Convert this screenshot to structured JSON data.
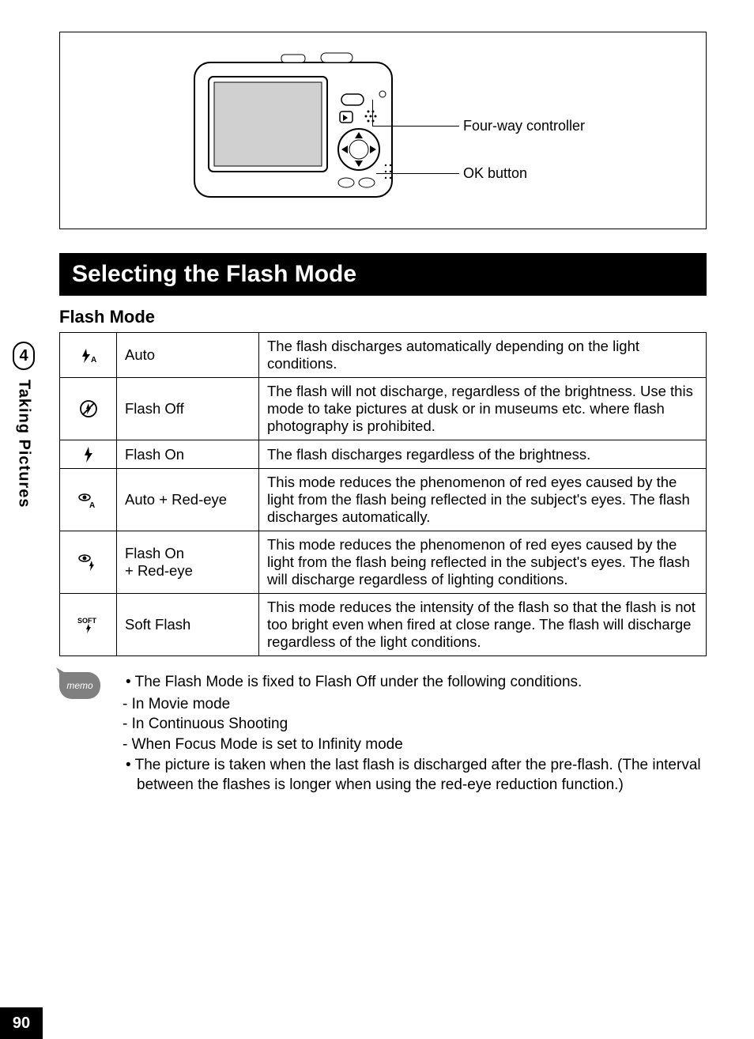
{
  "diagram": {
    "callout1": "Four-way controller",
    "callout2": "OK button"
  },
  "section_title": "Selecting the Flash Mode",
  "subtitle": "Flash Mode",
  "table": {
    "rows": [
      {
        "name": "Auto",
        "desc": "The flash discharges automatically depending on the light conditions."
      },
      {
        "name": "Flash Off",
        "desc": "The flash will not discharge, regardless of the brightness. Use this mode to take pictures at dusk or in museums etc. where flash photography is prohibited."
      },
      {
        "name": "Flash On",
        "desc": "The flash discharges regardless of the brightness."
      },
      {
        "name": "Auto + Red-eye",
        "desc": "This mode reduces the phenomenon of red eyes caused by the light from the flash being reflected in the subject's eyes. The flash discharges automatically."
      },
      {
        "name": "Flash On\n+ Red-eye",
        "desc": "This mode reduces the phenomenon of red eyes caused by the light from the flash being reflected in the subject's eyes. The flash will discharge regardless of lighting conditions."
      },
      {
        "name": "Soft Flash",
        "desc": "This mode reduces the intensity of the flash so that the flash is not too bright even when fired at close range. The flash will discharge regardless of the light conditions."
      }
    ]
  },
  "memo": {
    "badge": "memo",
    "bullet1": "The Flash Mode is fixed to Flash Off under the following conditions.",
    "dash1": "- In Movie mode",
    "dash2": "- In Continuous Shooting",
    "dash3": "- When Focus Mode is set to Infinity mode",
    "bullet2": "The picture is taken when the last flash is discharged after the pre-flash. (The interval between the flashes is longer when using the red-eye reduction function.)"
  },
  "side": {
    "chapter": "4",
    "label": "Taking Pictures"
  },
  "page_number": "90"
}
